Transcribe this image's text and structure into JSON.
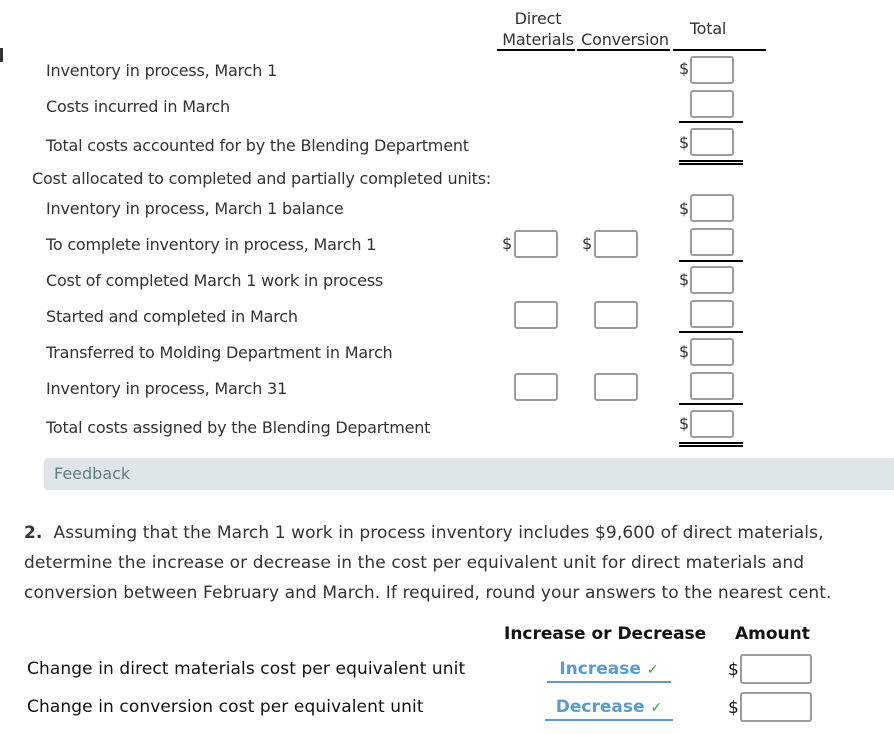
{
  "part1": {
    "columns": {
      "direct_materials_line1": "Direct",
      "direct_materials_line2": "Materials",
      "conversion": "Conversion",
      "total": "Total"
    },
    "currency_symbol": "$",
    "rows": [
      {
        "label": "Inventory in process, March 1",
        "indent": true
      },
      {
        "label": "Costs incurred in March",
        "indent": true
      },
      {
        "label": "Total costs accounted for by the Blending Department",
        "indent": true
      },
      {
        "label": "Cost allocated to completed and partially completed units:",
        "indent": false
      },
      {
        "label": "Inventory in process, March 1 balance",
        "indent": true
      },
      {
        "label": "To complete inventory in process, March 1",
        "indent": true
      },
      {
        "label": "Cost of completed March 1 work in process",
        "indent": true
      },
      {
        "label": "Started and completed in March",
        "indent": true
      },
      {
        "label": "Transferred to Molding Department in March",
        "indent": true
      },
      {
        "label": "Inventory in process, March 31",
        "indent": true
      },
      {
        "label": "Total costs assigned by the Blending Department",
        "indent": true
      }
    ],
    "inputs": {
      "total_inventory_march1": "",
      "total_costs_incurred": "",
      "total_costs_accounted": "",
      "total_inventory_balance": "",
      "dm_to_complete": "",
      "conv_to_complete": "",
      "total_to_complete": "",
      "total_cost_completed_wip": "",
      "dm_started_completed": "",
      "conv_started_completed": "",
      "total_started_completed": "",
      "total_transferred": "",
      "dm_inventory_march31": "",
      "conv_inventory_march31": "",
      "total_inventory_march31": "",
      "total_costs_assigned": ""
    }
  },
  "feedback": {
    "label": "Feedback"
  },
  "part2": {
    "number": "2.",
    "question": "Assuming that the March 1 work in process inventory includes $9,600 of direct materials, determine the increase or decrease in the cost per equivalent unit for direct materials and conversion between February and March. If required, round your answers to the nearest cent.",
    "headers": {
      "change": "Increase or Decrease",
      "amount": "Amount"
    },
    "rows": [
      {
        "label": "Change in direct materials cost per equivalent unit",
        "selection": "Increase",
        "status": "correct",
        "amount": ""
      },
      {
        "label": "Change in conversion cost per equivalent unit",
        "selection": "Decrease",
        "status": "correct",
        "amount": ""
      }
    ],
    "check_glyph": "✓",
    "currency_symbol": "$"
  },
  "colors": {
    "select_text": "#5b9bd1",
    "check": "#3aa345",
    "feedback_bg": "#dfe6ea",
    "feedback_text": "#5f7f80"
  }
}
